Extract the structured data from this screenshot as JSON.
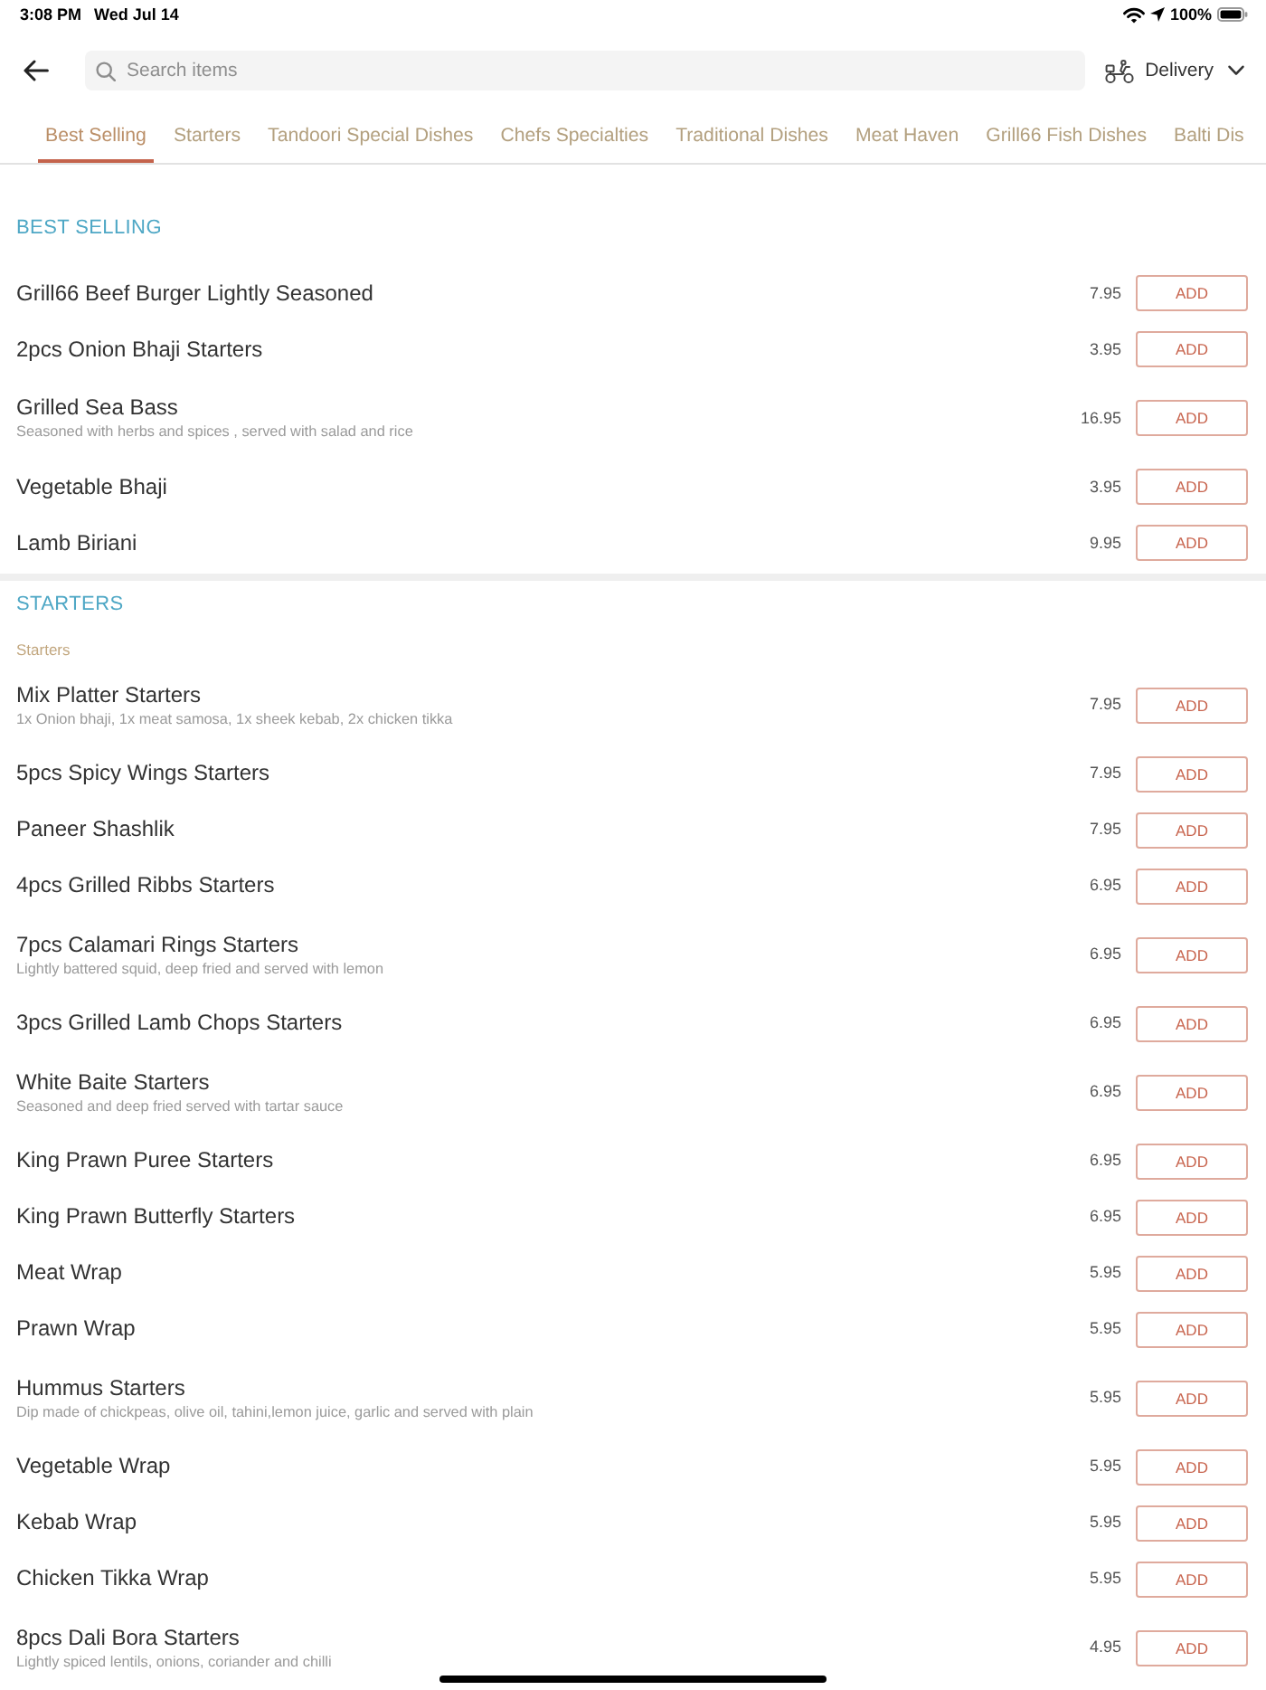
{
  "status_bar": {
    "time": "3:08 PM",
    "date": "Wed Jul 14",
    "battery": "100%"
  },
  "header": {
    "search": {
      "placeholder": "Search items"
    },
    "delivery": "Delivery"
  },
  "tabs": [
    {
      "label": "Best Selling",
      "selected": true
    },
    {
      "label": "Starters",
      "selected": false
    },
    {
      "label": "Tandoori Special Dishes",
      "selected": false
    },
    {
      "label": "Chefs Specialties",
      "selected": false
    },
    {
      "label": "Traditional Dishes",
      "selected": false
    },
    {
      "label": "Meat Haven",
      "selected": false
    },
    {
      "label": "Grill66 Fish Dishes",
      "selected": false
    },
    {
      "label": "Balti Dis",
      "selected": false
    }
  ],
  "sections": [
    {
      "title": "BEST SELLING",
      "items": [
        {
          "name": "Grill66 Beef Burger Lightly Seasoned",
          "price": "7.95",
          "action": "ADD"
        },
        {
          "name": "2pcs Onion Bhaji Starters",
          "price": "3.95",
          "action": "ADD"
        },
        {
          "name": "Grilled Sea Bass",
          "description": "Seasoned with herbs and spices , served with salad and rice",
          "price": "16.95",
          "action": "ADD"
        },
        {
          "name": "Vegetable Bhaji",
          "price": "3.95",
          "action": "ADD"
        },
        {
          "name": "Lamb Biriani",
          "price": "9.95",
          "action": "ADD"
        }
      ]
    },
    {
      "title": "STARTERS",
      "subtitle": "Starters",
      "items": [
        {
          "name": "Mix Platter Starters",
          "description": "1x Onion bhaji, 1x meat samosa, 1x sheek kebab, 2x chicken tikka",
          "price": "7.95",
          "action": "ADD"
        },
        {
          "name": "5pcs Spicy Wings Starters",
          "price": "7.95",
          "action": "ADD"
        },
        {
          "name": "Paneer Shashlik",
          "price": "7.95",
          "action": "ADD"
        },
        {
          "name": "4pcs Grilled Ribbs Starters",
          "price": "6.95",
          "action": "ADD"
        },
        {
          "name": "7pcs Calamari Rings Starters",
          "description": "Lightly battered squid, deep fried and served with lemon",
          "price": "6.95",
          "action": "ADD"
        },
        {
          "name": "3pcs Grilled Lamb Chops Starters",
          "price": "6.95",
          "action": "ADD"
        },
        {
          "name": "White Baite Starters",
          "description": "Seasoned and deep fried served with tartar sauce",
          "price": "6.95",
          "action": "ADD"
        },
        {
          "name": "King Prawn Puree Starters",
          "price": "6.95",
          "action": "ADD"
        },
        {
          "name": "King Prawn Butterfly Starters",
          "price": "6.95",
          "action": "ADD"
        },
        {
          "name": "Meat Wrap",
          "price": "5.95",
          "action": "ADD"
        },
        {
          "name": "Prawn Wrap",
          "price": "5.95",
          "action": "ADD"
        },
        {
          "name": "Hummus Starters",
          "description": "Dip made of chickpeas, olive oil, tahini,lemon juice, garlic and served with plain",
          "price": "5.95",
          "action": "ADD"
        },
        {
          "name": "Vegetable Wrap",
          "price": "5.95",
          "action": "ADD"
        },
        {
          "name": "Kebab Wrap",
          "price": "5.95",
          "action": "ADD"
        },
        {
          "name": "Chicken Tikka Wrap",
          "price": "5.95",
          "action": "ADD"
        },
        {
          "name": "8pcs Dali Bora Starters",
          "description": "Lightly spiced lentils, onions, coriander and chilli",
          "price": "4.95",
          "action": "ADD"
        }
      ]
    }
  ]
}
